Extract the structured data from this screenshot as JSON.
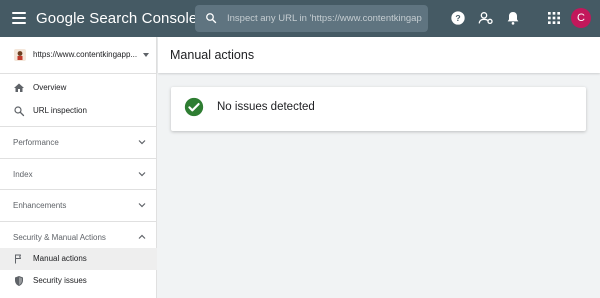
{
  "app": {
    "title": "Google Search Console"
  },
  "search": {
    "placeholder": "Inspect any URL in 'https://www.contentkingap"
  },
  "account": {
    "initial": "C"
  },
  "property": {
    "url": "https://www.contentkingapp..."
  },
  "sidebar": {
    "items": [
      {
        "label": "Overview",
        "icon": "home-icon"
      },
      {
        "label": "URL inspection",
        "icon": "search-icon"
      }
    ],
    "sections": [
      {
        "label": "Performance",
        "expanded": false
      },
      {
        "label": "Index",
        "expanded": false
      },
      {
        "label": "Enhancements",
        "expanded": false
      },
      {
        "label": "Security & Manual Actions",
        "expanded": true
      }
    ],
    "sub_items": [
      {
        "label": "Manual actions",
        "icon": "flag-icon",
        "active": true
      },
      {
        "label": "Security issues",
        "icon": "shield-icon",
        "active": false
      }
    ]
  },
  "main": {
    "title": "Manual actions",
    "status": {
      "text": "No issues detected",
      "icon": "check-circle-icon",
      "color": "#2e7d32"
    }
  },
  "colors": {
    "header": "#455a64",
    "avatar": "#c2185b",
    "success": "#2e7d32"
  }
}
